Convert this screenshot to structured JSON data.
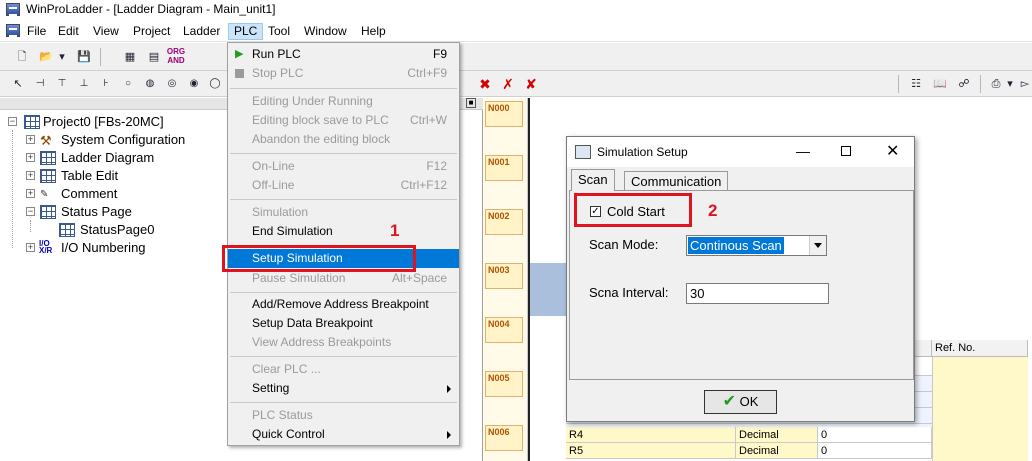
{
  "window": {
    "title": "WinProLadder - [Ladder Diagram - Main_unit1]"
  },
  "menubar": [
    "File",
    "Edit",
    "View",
    "Project",
    "Ladder",
    "PLC",
    "Tool",
    "Window",
    "Help"
  ],
  "plc_menu": [
    {
      "label": "Run PLC",
      "shortcut": "F9",
      "enabled": true,
      "icon": "play-icon"
    },
    {
      "label": "Stop PLC",
      "shortcut": "Ctrl+F9",
      "enabled": false,
      "icon": "stop-icon"
    },
    "sep",
    {
      "label": "Editing Under Running",
      "shortcut": "",
      "enabled": false
    },
    {
      "label": "Editing block save to PLC",
      "shortcut": "Ctrl+W",
      "enabled": false
    },
    {
      "label": "Abandon the editing block",
      "shortcut": "",
      "enabled": false
    },
    "sep",
    {
      "label": "On-Line",
      "shortcut": "F12",
      "enabled": false
    },
    {
      "label": "Off-Line",
      "shortcut": "Ctrl+F12",
      "enabled": false
    },
    "sep",
    {
      "label": "Simulation",
      "shortcut": "",
      "enabled": false
    },
    {
      "label": "End Simulation",
      "shortcut": "",
      "enabled": true
    },
    {
      "label": "Setup Simulation",
      "shortcut": "",
      "enabled": true,
      "selected": true
    },
    {
      "label": "Pause Simulation",
      "shortcut": "Alt+Space",
      "enabled": false
    },
    "sep",
    {
      "label": "Add/Remove Address Breakpoint",
      "shortcut": "",
      "enabled": true
    },
    {
      "label": "Setup Data Breakpoint",
      "shortcut": "",
      "enabled": true
    },
    {
      "label": "View Address Breakpoints",
      "shortcut": "",
      "enabled": false
    },
    "sep",
    {
      "label": "Clear PLC ...",
      "shortcut": "",
      "enabled": false
    },
    {
      "label": "Setting",
      "shortcut": "",
      "enabled": true,
      "submenu": true
    },
    "sep",
    {
      "label": "PLC Status",
      "shortcut": "",
      "enabled": false
    },
    {
      "label": "Quick Control",
      "shortcut": "",
      "enabled": true,
      "submenu": true
    }
  ],
  "tree": {
    "root": "Project0 [FBs-20MC]",
    "items": [
      "System Configuration",
      "Ladder Diagram",
      "Table Edit",
      "Comment",
      "Status Page",
      "StatusPage0",
      "I/O Numbering"
    ]
  },
  "rungs": [
    "N000",
    "N001",
    "N002",
    "N003",
    "N004",
    "N005",
    "N006"
  ],
  "annotations": {
    "step1": "1",
    "step2": "2"
  },
  "dialog": {
    "title": "Simulation Setup",
    "tabs": [
      "Scan",
      "Communication"
    ],
    "cold_start_label": "Cold Start",
    "cold_start_checked": true,
    "scan_mode_label": "Scan Mode:",
    "scan_mode_value": "Continous Scan",
    "interval_label": "Scna Interval:",
    "interval_value": "30",
    "ok_label": "OK"
  },
  "table": {
    "ref_header": "Ref. No.",
    "rows": [
      {
        "name": "R4",
        "format": "Decimal",
        "value": "0"
      },
      {
        "name": "R5",
        "format": "Decimal",
        "value": "0"
      }
    ]
  },
  "colors": {
    "highlight": "#0078d7",
    "annotation_red": "#e0141e"
  }
}
